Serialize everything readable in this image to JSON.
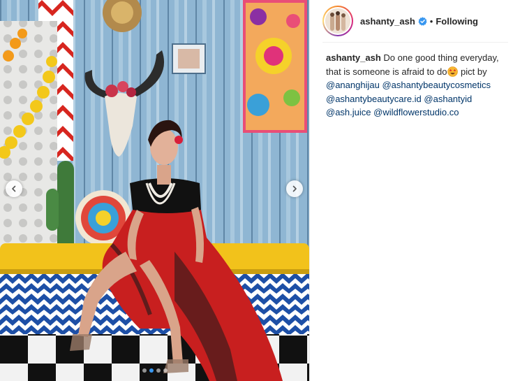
{
  "post": {
    "username": "ashanty_ash",
    "follow_separator": "•",
    "follow_status": "Following",
    "verified_icon": "verified-badge-icon",
    "carousel": {
      "slide_count": 4,
      "active_index": 1,
      "prev_icon": "chevron-left-icon",
      "next_icon": "chevron-right-icon"
    },
    "caption": {
      "username": "ashanty_ash",
      "text_1": "Do one good thing everyday, that is someone is afraid to do",
      "emoji_icon": "star-struck-emoji-icon",
      "text_2": " pict by ",
      "mentions": [
        "@ananghijau",
        "@ashantybeautycosmetics",
        "@ashantybeautycare.id",
        "@ashantyid",
        "@ash.juice",
        "@wildflowerstudio.co"
      ]
    }
  },
  "colors": {
    "accent_blue": "#3897f0",
    "mention": "#003569",
    "text": "#262626"
  }
}
